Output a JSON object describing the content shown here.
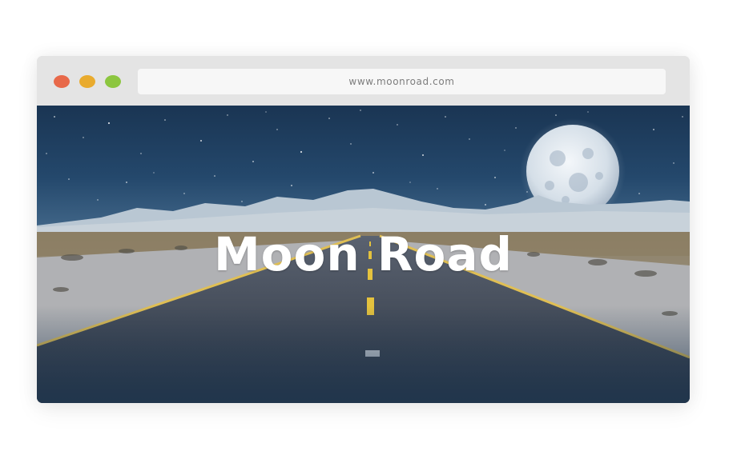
{
  "browser": {
    "url": "www.moonroad.com",
    "controls": {
      "close_color": "#e8694a",
      "minimize_color": "#e9ab2e",
      "maximize_color": "#8cc63f"
    }
  },
  "hero": {
    "title": "Moon Road",
    "image": "night-desert-road-with-full-moon"
  }
}
